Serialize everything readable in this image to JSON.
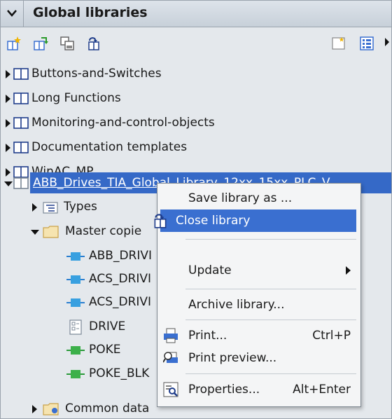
{
  "header": {
    "title": "Global libraries"
  },
  "tree": {
    "libraries": [
      "Buttons-and-Switches",
      "Long Functions",
      "Monitoring-and-control-objects",
      "Documentation templates",
      "WinAC_MP"
    ],
    "open_library": "ABB_Drives_TIA_Global_Library_12xx_15xx_PLC_V...",
    "types_label": "Types",
    "master_copies_label": "Master copie",
    "master_items": [
      "ABB_DRIVI",
      "ACS_DRIVI",
      "ACS_DRIVI",
      "DRIVE",
      "POKE",
      "POKE_BLK"
    ],
    "common_data_label": "Common data"
  },
  "context_menu": {
    "save_as": "Save library as ...",
    "close": "Close library",
    "update": "Update",
    "archive": "Archive library...",
    "print": "Print...",
    "print_shortcut": "Ctrl+P",
    "print_preview": "Print preview...",
    "properties": "Properties...",
    "properties_shortcut": "Alt+Enter"
  }
}
